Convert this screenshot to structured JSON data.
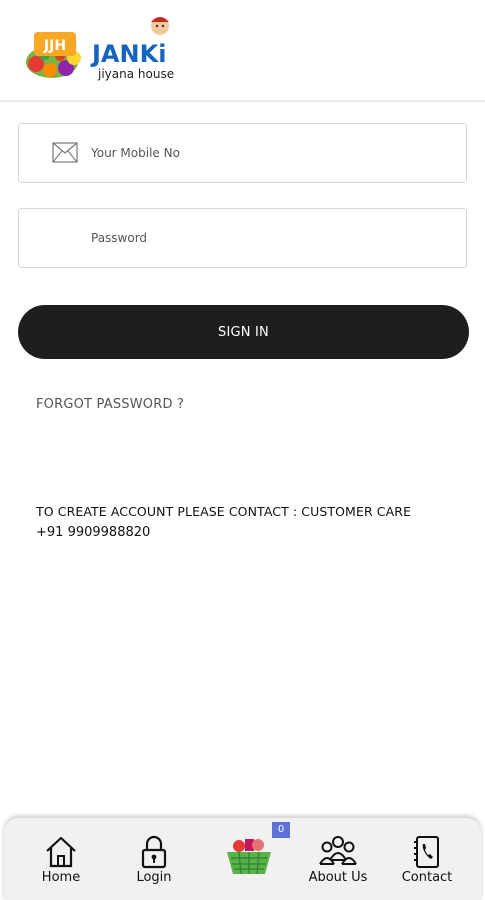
{
  "header": {
    "logo": {
      "badge_text": "JJH",
      "brand_name": "JANKi",
      "tagline": "jiyana house"
    }
  },
  "form": {
    "mobile_placeholder": "Your Mobile No",
    "password_placeholder": "Password",
    "signin_label": "SIGN IN",
    "forgot_label": "FORGOT PASSWORD ?"
  },
  "info": {
    "line1": "TO CREATE ACCOUNT PLEASE CONTACT : CUSTOMER CARE",
    "line2": "+91 9909988820"
  },
  "bottom_nav": {
    "items": [
      {
        "label": "Home",
        "icon": "home-icon"
      },
      {
        "label": "Login",
        "icon": "lock-icon"
      },
      {
        "label": "",
        "icon": "basket-icon",
        "badge": "0"
      },
      {
        "label": "About Us",
        "icon": "group-icon"
      },
      {
        "label": "Contact",
        "icon": "phone-book-icon"
      }
    ]
  },
  "colors": {
    "button_bg": "#1e1e1e",
    "badge_bg": "#5d72d8",
    "basket": "#57b247"
  }
}
